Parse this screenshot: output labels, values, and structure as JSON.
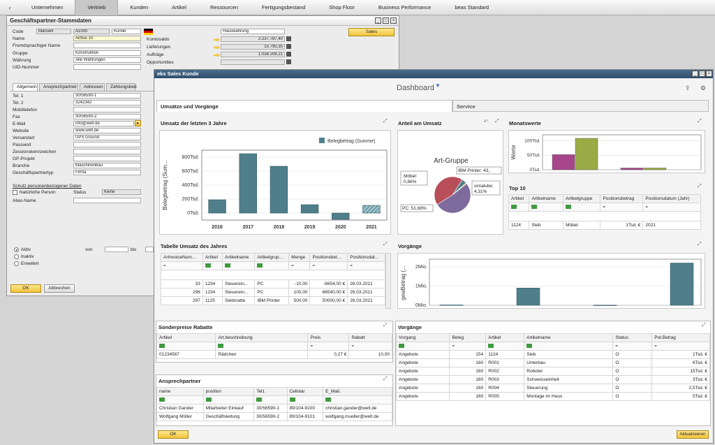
{
  "nav": {
    "back": "‹",
    "tabs": [
      "Unternehmen",
      "Vertrieb",
      "Kunden",
      "Artikel",
      "Ressourcen",
      "Fertigungsbestand",
      "Shop Floor",
      "Business Performance",
      "beas Standard"
    ],
    "active": "Vertrieb"
  },
  "bp": {
    "title": "Geschäftspartner-Stammdaten",
    "code_label": "Code",
    "code_series": "Manuell",
    "code_value": "A1000",
    "code_type": "Kunde",
    "name_label": "Name",
    "name_value": "Airbus 10",
    "foreign_name_label": "Fremdsprachiger Name",
    "group_label": "Gruppe",
    "group_value": "Konstruktion",
    "currency_label": "Währung",
    "currency_value": "Alle Währungen",
    "uid_label": "UID-Nummer",
    "house_currency": "Hauswährung",
    "balance_label": "Kontosaldo",
    "balance_value": "2.237.787,40",
    "deliveries_label": "Lieferungen",
    "deliveries_value": "15.795,35",
    "orders_label": "Aufträge",
    "orders_value": "1.038.208,21",
    "opportunities_label": "Opportunities",
    "sales_button": "Sales",
    "subtabs": [
      "Allgemein",
      "Ansprechpartner",
      "Adressen",
      "Zahlungsbed"
    ],
    "tel1_label": "Tel. 1",
    "tel1_value": "30/56590-1",
    "tel2_label": "Tel. 2",
    "tel2_value": "3242342",
    "mobile_label": "Mobiltelefon",
    "fax_label": "Fax",
    "fax_value": "30/56590-2",
    "email_label": "E-Mail",
    "email_value": "info@welt.de",
    "website_label": "Website",
    "website_value": "www.welt.de",
    "shipping_label": "Versandart",
    "shipping_value": "UPS Ground",
    "password_label": "Passwort",
    "assignment_label": "Zessionskennzeichen",
    "gp_project_label": "GP-Projekt",
    "industry_label": "Branche",
    "industry_value": "Maschinenbau",
    "bp_type_label": "Geschäftspartnertyp",
    "bp_type_value": "Firma",
    "privacy_link": "Schutz personenbezogener Daten",
    "natural_person_label": "Natürliche Person",
    "status_label": "Status",
    "status_value": "Keine",
    "alias_label": "Alias-Name",
    "active_label": "Aktiv",
    "inactive_label": "Inaktiv",
    "advanced_label": "Erweitert",
    "from_label": "von",
    "to_label": "bis",
    "ok_button": "OK",
    "cancel_button": "Abbrechen"
  },
  "sales": {
    "title": "eks Sales Kunde",
    "dashboard_title": "Dashboard",
    "section_tab": "Umsätze und Vorgänge",
    "service_tab": "Service",
    "ok_button": "OK",
    "refresh_button": "Aktualisieren"
  },
  "chart_revenue": {
    "title": "Umsatz der letzten 3 Jahre",
    "legend": "Belegbetrag (Summe)",
    "ylabel": "Belegbetrag (Sum...",
    "yticks": [
      "0Tsd.",
      "200Tsd.",
      "400Tsd.",
      "600Tsd.",
      "800Tsd."
    ],
    "categories": [
      "2016",
      "2017",
      "2018",
      "2019",
      "2020",
      "2021"
    ]
  },
  "chart_share": {
    "title": "Anteil am Umsatz",
    "subtitle": "Art-Gruppe",
    "label_ibm": "IBM Printer: 43,",
    "label_moebel": "Möbel: 0,86%",
    "label_simalube": "simalube: 4,31%",
    "label_pc": "PC: 51,68%"
  },
  "chart_month": {
    "title": "Monatswerte",
    "ylabel": "Werte",
    "yticks": [
      "0Tsd.",
      "50Tsd.",
      "100Tsd."
    ]
  },
  "top10": {
    "title": "Top 10",
    "headers": [
      "Artikel",
      "Artikelname",
      "Artikelgruppe",
      "Positionsbetrag",
      "Positionsdatum (Jahr)"
    ],
    "filters": [
      "=",
      "=",
      "=",
      "=",
      "="
    ],
    "row": [
      "1124",
      "Sieb",
      "Möbel",
      "1Tsd. €",
      "2021"
    ]
  },
  "annual_table": {
    "title": "Tabelle Umsatz des Jahres",
    "headers": [
      "ArInvoiceNum...",
      "Artikel",
      "Artikelname",
      "Artikelgrup...",
      "Menge",
      "Positionsbet...",
      "Positionsdat..."
    ],
    "filters": [
      "=",
      "=",
      "=",
      "=",
      "=",
      "=",
      "="
    ],
    "rows": [
      [
        "33",
        "1234",
        "Steuerein...",
        "PC",
        "-10,00",
        "-6654,00 €",
        "26.03.2021"
      ],
      [
        "296",
        "1234",
        "Steuerein...",
        "PC",
        "100,00",
        "66540,00 €",
        "26.03.2021"
      ],
      [
        "297",
        "1125",
        "Siebmatte",
        "IBM Printer",
        "500,00",
        "50000,00 €",
        "26.03.2021"
      ]
    ]
  },
  "chart_proc": {
    "title": "Vorgänge",
    "ylabel": "gewBetrag (...",
    "yticks": [
      "0Mio.",
      "1Mio.",
      "2Mio."
    ]
  },
  "special_prices": {
    "title": "Sonderpreise Rabatte",
    "headers": [
      "Artikel",
      "Art.beschreibung",
      "Preis",
      "Rabatt"
    ],
    "filters": [
      "=",
      "=",
      "=",
      "="
    ],
    "row": [
      "01234567",
      "Rädchen",
      "0,27 €",
      "10,00"
    ]
  },
  "contacts": {
    "title": "Ansprechpartner",
    "headers": [
      "name",
      "position",
      "Tel1",
      "Cellolar",
      "E_Mail."
    ],
    "filters": [
      "=",
      "=",
      "=",
      "=",
      "="
    ],
    "rows": [
      [
        "Christian Gander",
        "Mitarbeiter Einkauf",
        "30/56590-1",
        "89/104-9100",
        "christian.gander@welt.de"
      ],
      [
        "Wolfgang Müller",
        "Geschäftsleitung",
        "30/56590-2",
        "89/104-9101",
        "wolfgang.mueller@welt.de"
      ]
    ]
  },
  "processes": {
    "title": "Vorgänge",
    "headers": [
      "Vorgang",
      "Beleg",
      "Artikel",
      "Artikelname",
      "Status",
      "Pot.Betrag"
    ],
    "filters": [
      "=",
      "=",
      "=",
      "=",
      "=",
      "="
    ],
    "rows": [
      [
        "Angebote",
        "154",
        "1124",
        "Sieb",
        "O",
        "1Tsd. €"
      ],
      [
        "Angebote",
        "160",
        "R001",
        "Unterbau",
        "O",
        "6Tsd. €"
      ],
      [
        "Angebote",
        "160",
        "R002",
        "Roboter",
        "O",
        "15Tsd. €"
      ],
      [
        "Angebote",
        "160",
        "R003",
        "Schweisseinheit",
        "O",
        "3Tsd. €"
      ],
      [
        "Angebote",
        "160",
        "R004",
        "Steuerung",
        "O",
        "2,5Tsd. €"
      ],
      [
        "Angebote",
        "160",
        "R005",
        "Montage im Haus",
        "O",
        "5Tsd. €"
      ]
    ]
  },
  "chart_data": [
    {
      "type": "bar",
      "title": "Umsatz der letzten 3 Jahre",
      "ylabel": "Belegbetrag (Sum...",
      "categories": [
        "2016",
        "2017",
        "2018",
        "2019",
        "2020",
        "2021"
      ],
      "series": [
        {
          "name": "Belegbetrag (Summe)",
          "values": [
            190000,
            850000,
            670000,
            120000,
            -90000,
            110000
          ]
        }
      ],
      "ylim": [
        -100000,
        900000
      ],
      "grid": true,
      "legend": "top-right",
      "colors": {
        "bar": "#4f7f8a",
        "last": "hatched"
      }
    },
    {
      "type": "pie",
      "title": "Anteil am Umsatz",
      "subtitle": "Art-Gruppe",
      "labels": [
        "PC",
        "IBM Printer",
        "simalube",
        "Möbel"
      ],
      "values": [
        51.68,
        43.15,
        4.31,
        0.86
      ],
      "colors": [
        "#7e6a9c",
        "#b84e5a",
        "#4f7f8a",
        "#c9a64e"
      ]
    },
    {
      "type": "bar",
      "title": "Monatswerte",
      "ylabel": "Werte",
      "values": [
        52000,
        108000,
        6000,
        6000
      ],
      "colors": [
        "#a8468a",
        "#9aab45",
        "#a8468a",
        "#9aab45"
      ],
      "ylim": [
        0,
        120000
      ],
      "grid": true
    },
    {
      "type": "bar",
      "title": "Vorgänge",
      "ylabel": "gewBetrag (...",
      "values": [
        20000,
        900000,
        10000,
        2200000
      ],
      "ylim": [
        0,
        2400000
      ],
      "grid": true,
      "colors": {
        "bar": "#4f7f8a"
      }
    }
  ]
}
